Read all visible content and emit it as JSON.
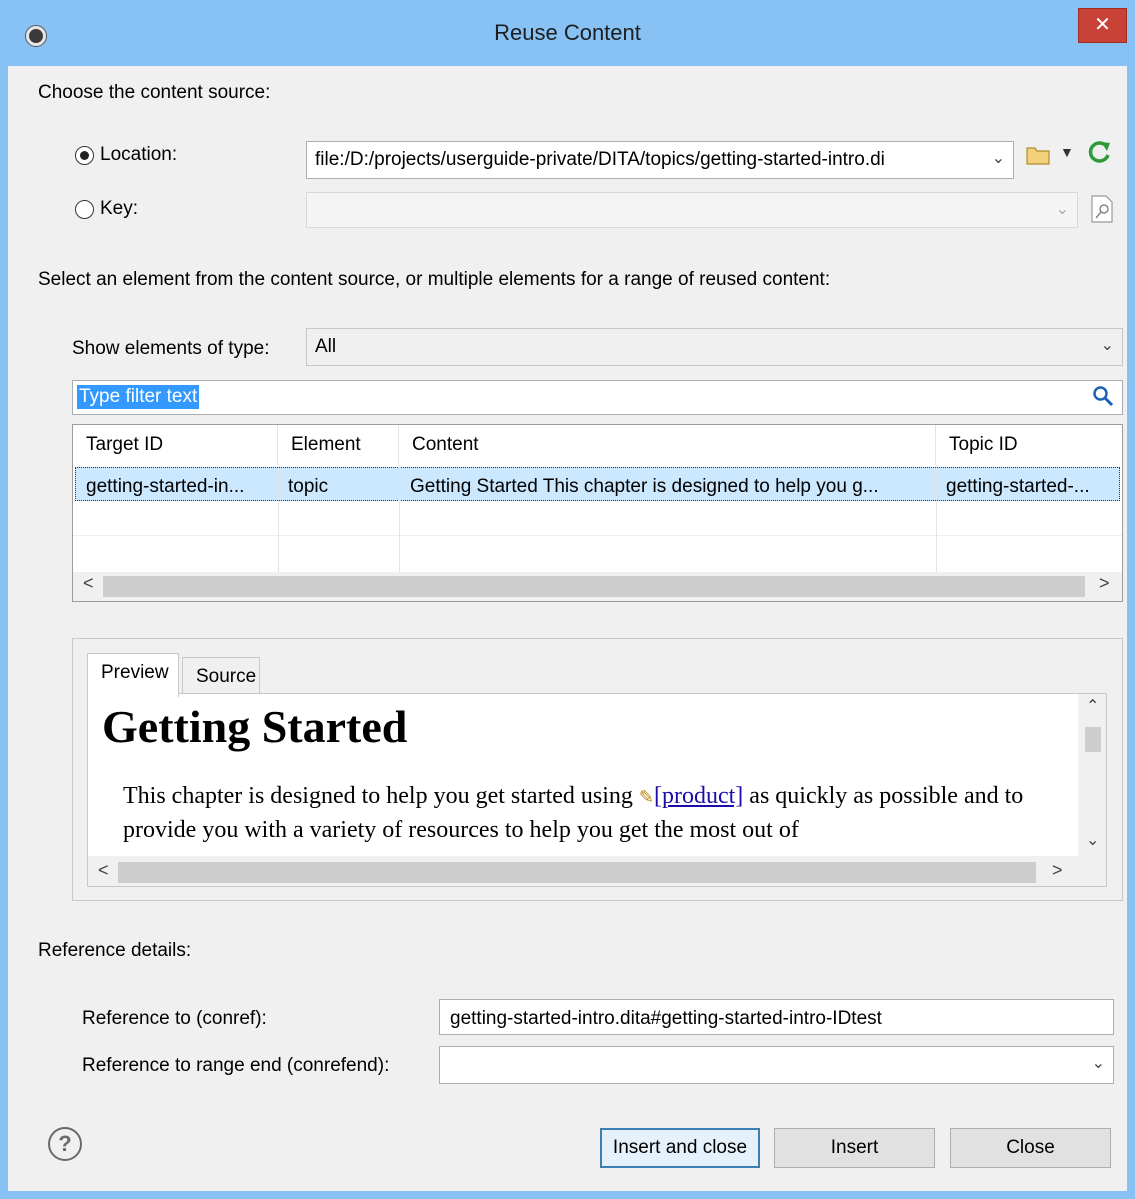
{
  "window": {
    "title": "Reuse Content",
    "close_glyph": "✕"
  },
  "source": {
    "heading": "Choose the content source:",
    "location_label": "Location:",
    "location_value": "file:/D:/projects/userguide-private/DITA/topics/getting-started-intro.di",
    "key_label": "Key:",
    "key_value": ""
  },
  "select": {
    "instruction": "Select an element from the content source, or multiple elements for a range of reused content:",
    "type_label": "Show elements of type:",
    "type_value": "All",
    "filter_placeholder": "Type filter text"
  },
  "table": {
    "headers": [
      "Target ID",
      "Element",
      "Content",
      "Topic ID"
    ],
    "rows": [
      [
        "getting-started-in...",
        "topic",
        "Getting Started This chapter is designed to help you g...",
        "getting-started-..."
      ]
    ]
  },
  "preview": {
    "tabs": [
      "Preview",
      "Source"
    ],
    "title": "Getting Started",
    "text_before_link": "This chapter is designed to help you get started using ",
    "link_text": "[product]",
    "text_after_link": " as quickly as possible and to provide you with a variety of resources to help you get the most out of"
  },
  "details": {
    "heading": "Reference details:",
    "conref_label": "Reference to (conref):",
    "conref_value": "getting-started-intro.dita#getting-started-intro-IDtest",
    "conrefend_label": "Reference to range end  (conrefend):",
    "conrefend_value": ""
  },
  "buttons": {
    "insert_close": "Insert and close",
    "insert": "Insert",
    "close": "Close",
    "help": "?"
  },
  "icons": {
    "folder": "folder-icon",
    "refresh": "refresh-icon",
    "search": "search-icon"
  },
  "colors": {
    "title_bar": "#88c2f5",
    "close_button": "#c84238",
    "selection": "#cce8ff",
    "link": "#1a0dab"
  }
}
